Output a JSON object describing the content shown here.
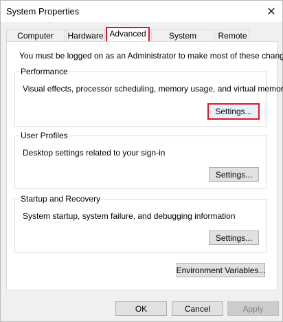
{
  "window": {
    "title": "System Properties",
    "close_glyph": "✕"
  },
  "tabs": [
    {
      "label": "Computer Name",
      "active": false
    },
    {
      "label": "Hardware",
      "active": false
    },
    {
      "label": "Advanced",
      "active": true
    },
    {
      "label": "System Protection",
      "active": false
    },
    {
      "label": "Remote",
      "active": false
    }
  ],
  "advanced": {
    "notice": "You must be logged on as an Administrator to make most of these changes.",
    "performance": {
      "title": "Performance",
      "description": "Visual effects, processor scheduling, memory usage, and virtual memory",
      "button": "Settings..."
    },
    "user_profiles": {
      "title": "User Profiles",
      "description": "Desktop settings related to your sign-in",
      "button": "Settings..."
    },
    "startup_recovery": {
      "title": "Startup and Recovery",
      "description": "System startup, system failure, and debugging information",
      "button": "Settings..."
    },
    "env_button": "Environment Variables..."
  },
  "footer": {
    "ok": "OK",
    "cancel": "Cancel",
    "apply": "Apply"
  },
  "colors": {
    "highlight": "#e81123",
    "window_bg": "#f0f0f0",
    "panel_bg": "#ffffff"
  }
}
